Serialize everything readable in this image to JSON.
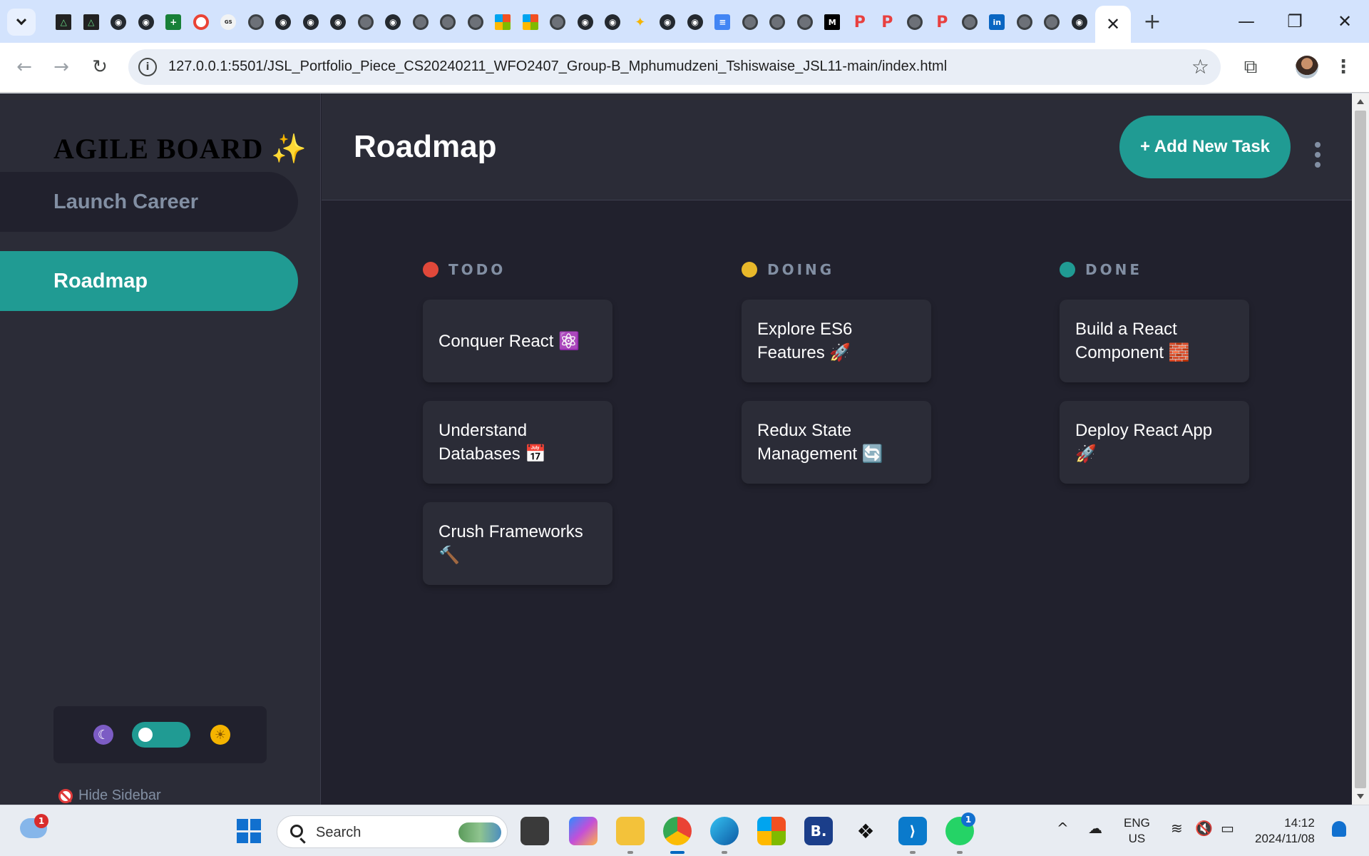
{
  "browser": {
    "url": "127.0.0.1:5501/JSL_Portfolio_Piece_CS20240211_WFO2407_Group-B_Mphumudzeni_Tshiswaise_JSL11-main/index.html",
    "tab_favicons": [
      "triangle",
      "triangle",
      "github",
      "github",
      "sheets-plus",
      "google-lens",
      "logo",
      "globe",
      "github",
      "github",
      "github",
      "globe",
      "github",
      "globe",
      "globe",
      "globe",
      "microsoft",
      "microsoft",
      "chrome",
      "github",
      "github",
      "sparkle",
      "github",
      "github",
      "docs",
      "chrome",
      "globe",
      "globe",
      "medium",
      "p",
      "p",
      "chrome",
      "p",
      "globe",
      "linkedin",
      "globe",
      "globe",
      "github"
    ],
    "active_tab_close": "✕",
    "new_tab": "+",
    "window_controls": {
      "minimize": "—",
      "restore": "❐",
      "close": "✕"
    },
    "nav": {
      "back": "←",
      "forward": "→",
      "reload": "↻"
    },
    "site_info": "i",
    "bookmark_star": "☆",
    "extensions": "⧉",
    "menu": "⋮"
  },
  "sidebar": {
    "logo": "AGILE BOARD ✨",
    "boards": [
      {
        "label": "Launch Career",
        "active": false
      },
      {
        "label": "Roadmap",
        "active": true
      }
    ],
    "theme_toggle": {
      "dark_icon": "☾",
      "light_icon": "☀",
      "state": "dark"
    },
    "hide_label": "Hide Sidebar"
  },
  "header": {
    "board_title": "Roadmap",
    "add_task_label": "+ Add New Task"
  },
  "columns": [
    {
      "title": "TODO",
      "dot_color": "#e0483a",
      "tasks": [
        "Conquer React ⚛️",
        "Understand Databases 📅",
        "Crush Frameworks 🔨"
      ]
    },
    {
      "title": "DOING",
      "dot_color": "#e8b82a",
      "tasks": [
        "Explore ES6 Features 🚀",
        "Redux State Management 🔄"
      ]
    },
    {
      "title": "DONE",
      "dot_color": "#209b93",
      "tasks": [
        "Build a React Component 🧱",
        "Deploy React App 🚀"
      ]
    }
  ],
  "taskbar": {
    "weather_badge": "1",
    "search_placeholder": "Search",
    "apps": [
      "file-explorer-alt",
      "copilot",
      "file-explorer",
      "chrome",
      "edge",
      "microsoft-store",
      "booking",
      "dropbox",
      "vscode",
      "whatsapp"
    ],
    "whatsapp_badge": "1",
    "tray": {
      "chevron": "^",
      "lang_line1": "ENG",
      "lang_line2": "US"
    },
    "clock": {
      "time": "14:12",
      "date": "2024/11/08"
    }
  },
  "colors": {
    "accent": "#209b93",
    "sidebar_bg": "#2b2c37",
    "board_bg": "#21212d",
    "muted_text": "#828fa3"
  }
}
